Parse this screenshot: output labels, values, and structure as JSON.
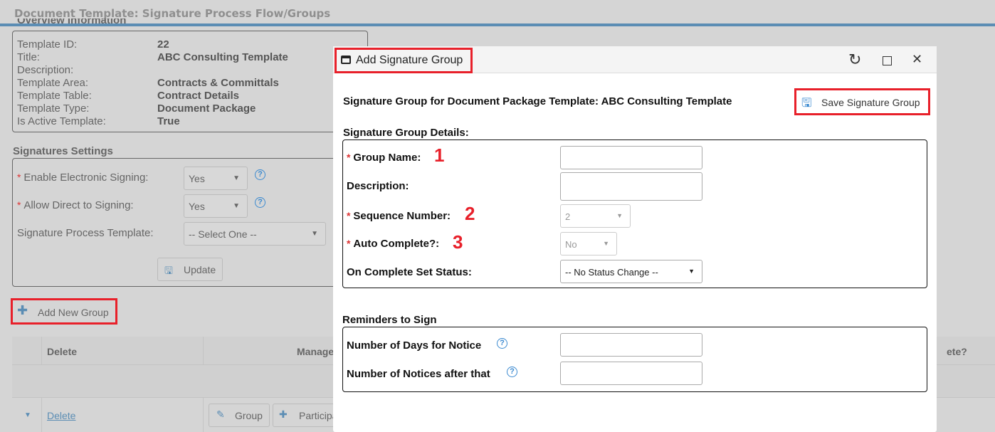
{
  "page": {
    "title": "Document Template: Signature Process Flow/Groups",
    "section_overview": "Overview Information"
  },
  "overview": [
    {
      "label": "Template ID:",
      "value": "22"
    },
    {
      "label": "Title:",
      "value": "ABC Consulting Template"
    },
    {
      "label": "Description:",
      "value": ""
    },
    {
      "label": "Template Area:",
      "value": "Contracts & Committals"
    },
    {
      "label": "Template Table:",
      "value": "Contract Details"
    },
    {
      "label": "Template Type:",
      "value": "Document Package"
    },
    {
      "label": "Is Active Template:",
      "value": "True"
    }
  ],
  "signatures": {
    "heading": "Signatures Settings",
    "enable_label": "Enable Electronic Signing:",
    "enable_value": "Yes",
    "direct_label": "Allow Direct to Signing:",
    "direct_value": "Yes",
    "process_label": "Signature Process Template:",
    "process_value": "-- Select One --",
    "update": "Update"
  },
  "add_group": "Add New Group",
  "table": {
    "headers": [
      "Delete",
      "Manage",
      "ete?"
    ],
    "row": {
      "delete": "Delete",
      "group_btn": "Group",
      "participant_btn": "Participa"
    }
  },
  "modal": {
    "title": "Add Signature Group",
    "heading": "Signature Group for Document Package Template: ABC Consulting Template",
    "save": "Save Signature Group",
    "details_heading": "Signature Group Details:",
    "group_name": "Group Name:",
    "description": "Description:",
    "sequence": "Sequence Number:",
    "sequence_value": "2",
    "auto_complete": "Auto Complete?:",
    "auto_value": "No",
    "on_complete": "On Complete Set Status:",
    "on_complete_value": "-- No Status Change --",
    "reminders_heading": "Reminders to Sign",
    "days_notice": "Number of Days for Notice",
    "notices_after": "Number of Notices after that",
    "annotations": [
      "1",
      "2",
      "3"
    ]
  },
  "colors": {
    "highlight": "#e8202a",
    "accent": "#5b8db4"
  }
}
